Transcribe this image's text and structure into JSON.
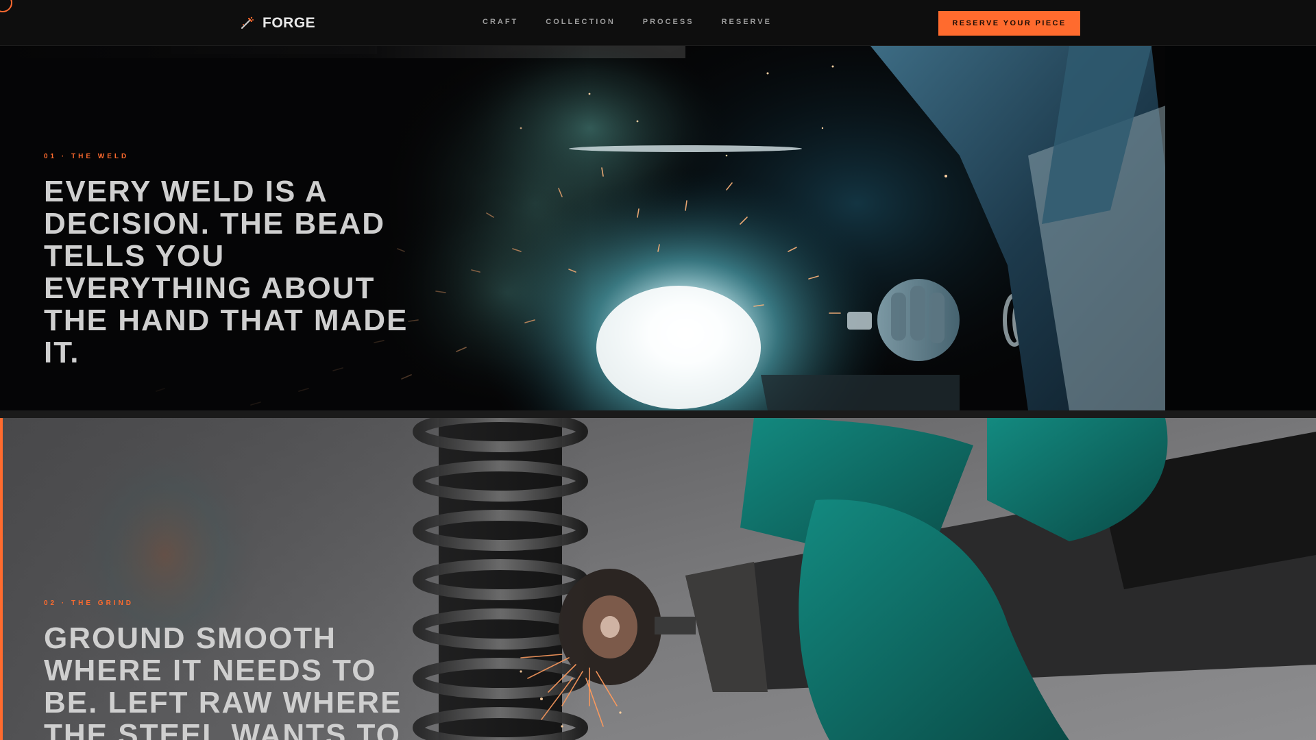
{
  "nav": {
    "brand": {
      "name": "FORGE",
      "icon": "spark-torch-icon"
    },
    "links": [
      {
        "label": "CRAFT"
      },
      {
        "label": "COLLECTION"
      },
      {
        "label": "PROCESS"
      },
      {
        "label": "RESERVE"
      }
    ],
    "cta_label": "RESERVE YOUR PIECE"
  },
  "sections": [
    {
      "eyebrow": "01 · THE WELD",
      "headline": "EVERY WELD IS A DECISION. THE BEAD TELLS YOU EVERYTHING ABOUT THE HAND THAT MADE IT."
    },
    {
      "eyebrow": "02 · THE GRIND",
      "headline": "GROUND SMOOTH WHERE IT NEEDS TO BE. LEFT RAW WHERE THE STEEL WANTS TO"
    }
  ],
  "colors": {
    "accent": "#ff6b2e",
    "nav_background": "#0e0e0e",
    "headline": "#cfcfcf",
    "weld_glow": "#bff4ff",
    "glove": "#0f7a72"
  }
}
